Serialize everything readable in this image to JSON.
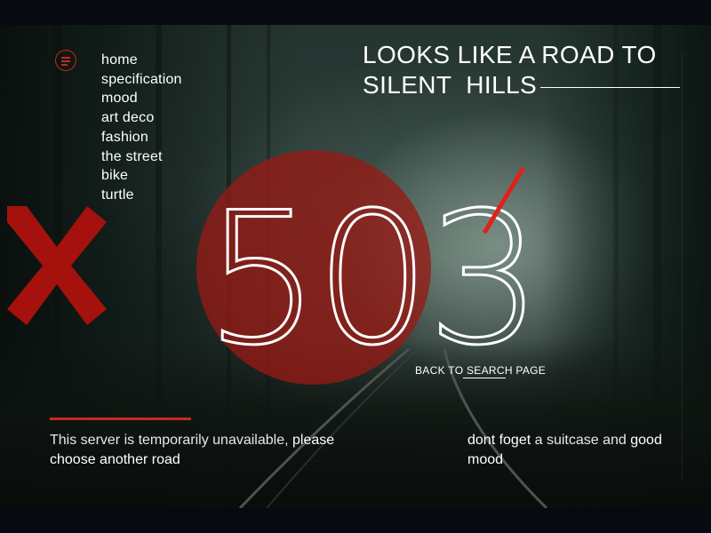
{
  "nav": {
    "items": [
      {
        "label": "home"
      },
      {
        "label": "specification"
      },
      {
        "label": "mood"
      },
      {
        "label": "art deco"
      },
      {
        "label": "fashion"
      },
      {
        "label": "the street"
      },
      {
        "label": "bike"
      },
      {
        "label": "turtle"
      }
    ]
  },
  "headline": {
    "line1": "LOOKS LIKE A ROAD TO",
    "line2": "SILENT  HILLS"
  },
  "error": {
    "code_part1": "50",
    "code_part2": "3"
  },
  "back_link": {
    "prefix": "BACK TO ",
    "emphasis": "SEARCH",
    "suffix": " PAGE"
  },
  "message_left": {
    "part1": "This server is temporarily unavailable, ",
    "part2": "please choose another road"
  },
  "message_right": {
    "part1": "dont foget",
    "part2": " a suitcase and ",
    "part3": "good mood"
  },
  "icons": {
    "menu": "hamburger-menu-icon",
    "close": "close-x-icon"
  },
  "colors": {
    "accent": "#c8281e",
    "circle": "#961a14",
    "text": "#ffffff"
  }
}
